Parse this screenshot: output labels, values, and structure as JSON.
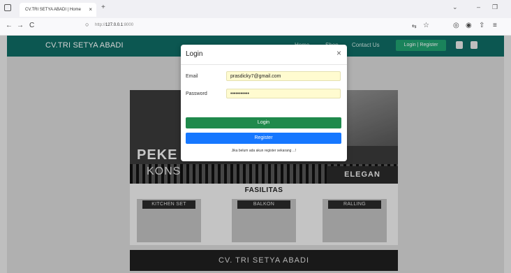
{
  "browser": {
    "tab_title": "CV.TRI SETYA ABADI | Home",
    "tab_close": "×",
    "new_tab": "+",
    "url_prefix": "http://",
    "url_host": "127.0.0.1",
    "url_port": ":8000",
    "nav_back": "←",
    "nav_forward": "→",
    "nav_reload": "C"
  },
  "site": {
    "brand": "CV.TRI SETYA ABADI",
    "menu": [
      "Home",
      "Shop",
      "Contact Us"
    ],
    "login_register": "Login | Register"
  },
  "hero": {
    "line1": "PEKE",
    "line2": "KONS",
    "elegan": "ELEGAN"
  },
  "fasilitas": {
    "title": "FASILITAS",
    "items": [
      "KITCHEN SET",
      "BALKON",
      "RALLING"
    ]
  },
  "footer": {
    "text": "CV. TRI SETYA ABADI"
  },
  "modal": {
    "title": "Login",
    "close": "×",
    "email_label": "Email",
    "email_value": "prasdicky7@gmail.com",
    "password_label": "Password",
    "password_value": "•••••••••••",
    "login_button": "Login",
    "register_button": "Register",
    "hint": "Jika belum ada akun register sekarang ...!"
  },
  "colors": {
    "header": "#0f6b63",
    "login_green": "#1f8a4c",
    "register_blue": "#1677ff",
    "input_bg": "#fffbd0"
  }
}
